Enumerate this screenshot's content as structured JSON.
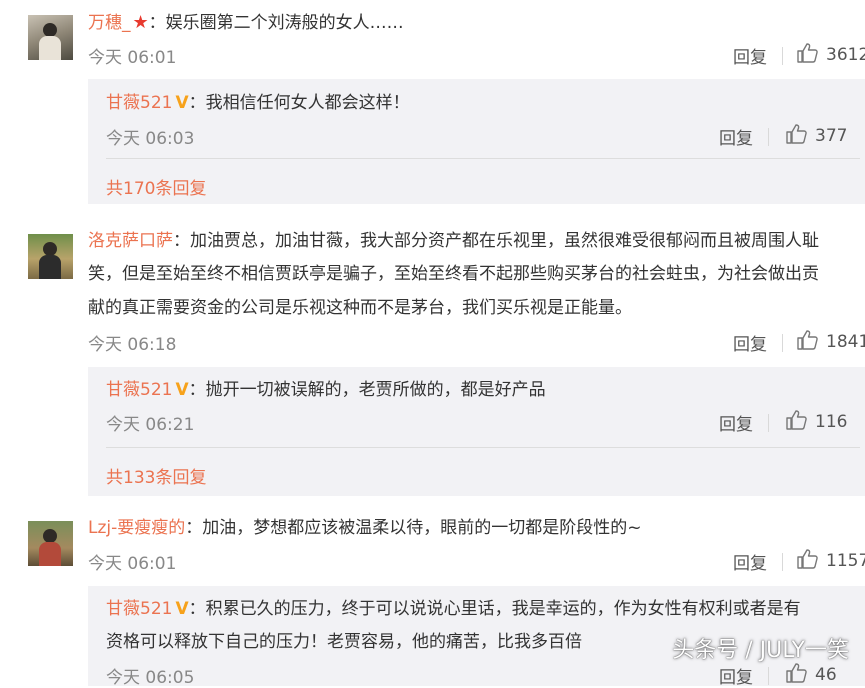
{
  "comments": [
    {
      "username": "万穗_",
      "badge": "star",
      "text": "：娱乐圈第二个刘涛般的女人……",
      "time": "今天 06:01",
      "reply_label": "回复",
      "likes": "3612",
      "sub": {
        "username": "甘薇521",
        "badge": "v",
        "text": "：我相信任何女人都会这样！",
        "time": "今天 06:03",
        "reply_label": "回复",
        "likes": "377",
        "more": "共170条回复"
      }
    },
    {
      "username": "洛克萨口萨",
      "text_lines": [
        "：加油贾总，加油甘薇，我大部分资产都在乐视里，虽然很难受很郁闷而且被周围人耻",
        "笑，但是至始至终不相信贾跃亭是骗子，至始至终看不起那些购买茅台的社会蛀虫，为社会做出贡",
        "献的真正需要资金的公司是乐视这种而不是茅台，我们买乐视是正能量。"
      ],
      "time": "今天 06:18",
      "reply_label": "回复",
      "likes": "1841",
      "sub": {
        "username": "甘薇521",
        "badge": "v",
        "text": "：抛开一切被误解的，老贾所做的，都是好产品",
        "time": "今天 06:21",
        "reply_label": "回复",
        "likes": "116",
        "more": "共133条回复"
      }
    },
    {
      "username": "Lzj-要瘦瘦的",
      "text": "：加油，梦想都应该被温柔以待，眼前的一切都是阶段性的~",
      "time": "今天 06:01",
      "reply_label": "回复",
      "likes": "1157",
      "sub": {
        "username": "甘薇521",
        "badge": "v",
        "text_lines": [
          "：积累已久的压力，终于可以说说心里话，我是幸运的，作为女性有权利或者是有",
          "资格可以释放下自己的压力！老贾容易，他的痛苦，比我多百倍"
        ],
        "time": "今天 06:05",
        "reply_label": "回复",
        "likes": "46"
      }
    }
  ],
  "watermark": "头条号 / JULY一笑",
  "colors": {
    "username": "#eb7350",
    "text": "#333333",
    "meta": "#888888",
    "subbox_bg": "#f2f2f5",
    "v_badge": "#f7a21b",
    "star_badge": "#e83a2f"
  },
  "icons": {
    "like": "thumbs-up-icon",
    "v_badge": "verified-v-icon",
    "star_badge": "star-icon"
  }
}
